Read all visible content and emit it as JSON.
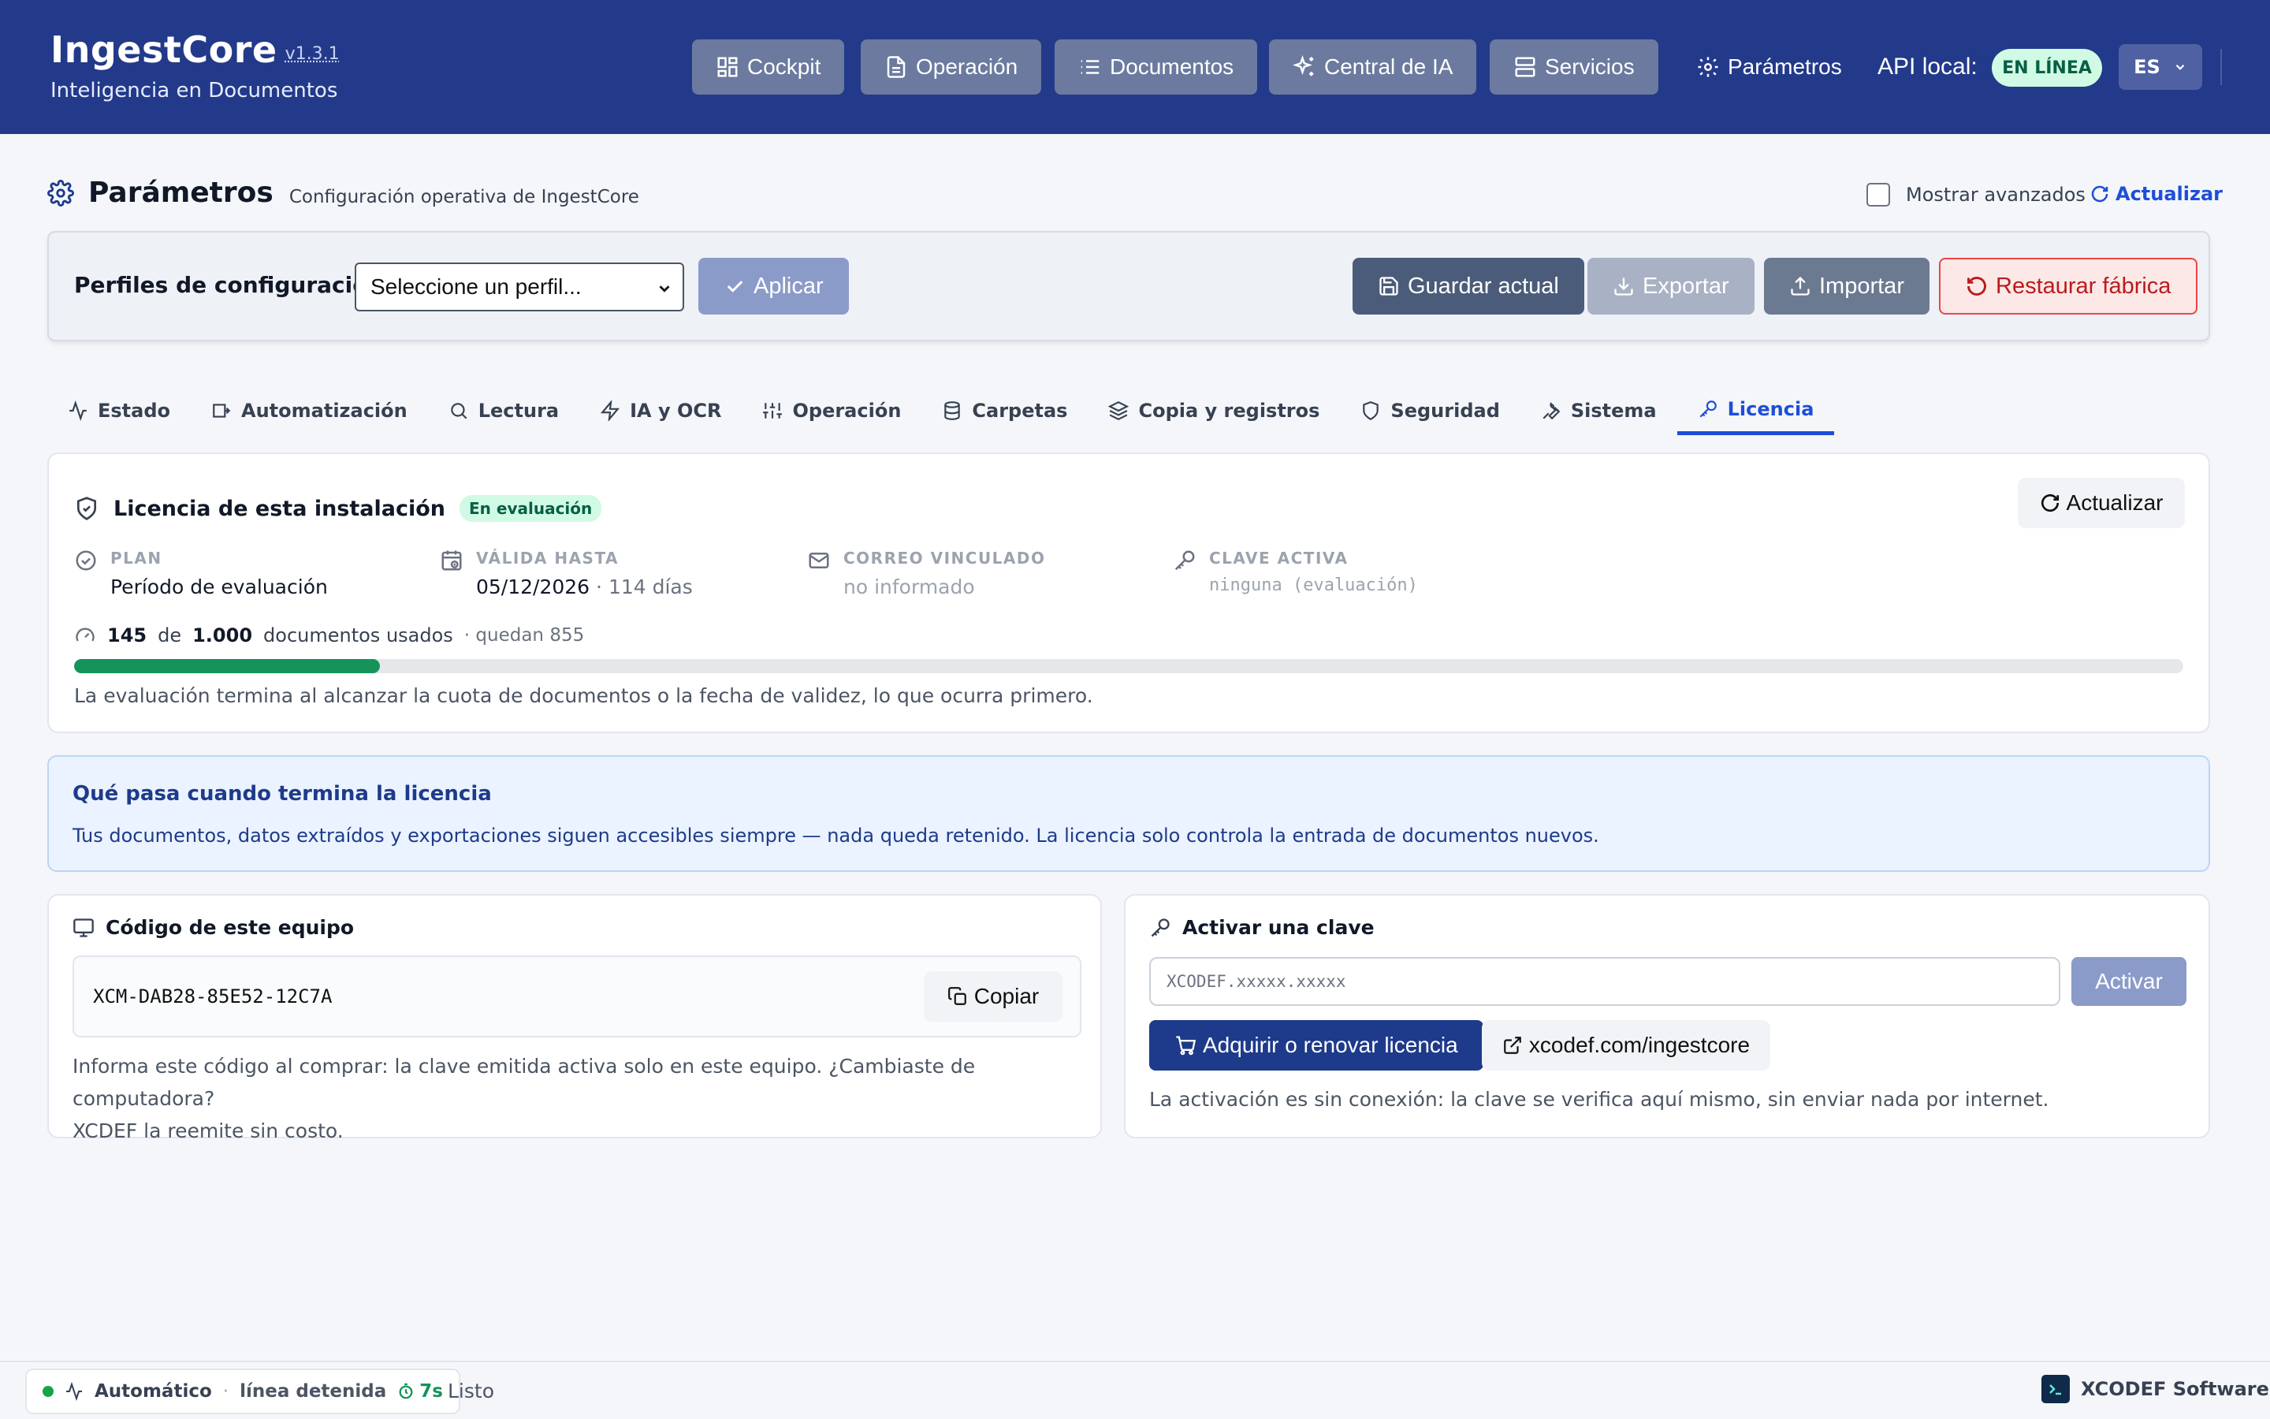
{
  "app": {
    "name": "IngestCore",
    "version": "v1.3.1",
    "subtitle": "Inteligencia en Documentos"
  },
  "nav": {
    "items": [
      {
        "label": "Cockpit",
        "icon": "dashboard-icon"
      },
      {
        "label": "Operación",
        "icon": "document-icon"
      },
      {
        "label": "Documentos",
        "icon": "list-icon"
      },
      {
        "label": "Central de IA",
        "icon": "sparkles-icon"
      },
      {
        "label": "Servicios",
        "icon": "server-icon"
      }
    ],
    "params_label": "Parámetros",
    "api_label": "API local:",
    "api_status": "EN LÍNEA",
    "language": "ES"
  },
  "page": {
    "title": "Parámetros",
    "subtitle": "Configuración operativa de IngestCore",
    "show_advanced": "Mostrar avanzados",
    "refresh": "Actualizar"
  },
  "profiles": {
    "label": "Perfiles de configuración:",
    "select_placeholder": "Seleccione un perfil...",
    "apply": "Aplicar",
    "save_current": "Guardar actual",
    "export": "Exportar",
    "import": "Importar",
    "factory_reset": "Restaurar fábrica"
  },
  "tabs": [
    {
      "label": "Estado",
      "icon": "activity-icon"
    },
    {
      "label": "Automatización",
      "icon": "inbox-icon"
    },
    {
      "label": "Lectura",
      "icon": "search-icon"
    },
    {
      "label": "IA y OCR",
      "icon": "bolt-icon"
    },
    {
      "label": "Operación",
      "icon": "sliders-icon"
    },
    {
      "label": "Carpetas",
      "icon": "database-icon"
    },
    {
      "label": "Copia y registros",
      "icon": "layers-icon"
    },
    {
      "label": "Seguridad",
      "icon": "shield-icon"
    },
    {
      "label": "Sistema",
      "icon": "wrench-icon"
    },
    {
      "label": "Licencia",
      "icon": "key-icon",
      "active": true
    }
  ],
  "license": {
    "title": "Licencia de esta instalación",
    "badge": "En evaluación",
    "refresh": "Actualizar",
    "plan_label": "PLAN",
    "plan_value": "Período de evaluación",
    "valid_label": "VÁLIDA HASTA",
    "valid_date": "05/12/2026",
    "valid_days": "· 114 días",
    "email_label": "CORREO VINCULADO",
    "email_value": "no informado",
    "key_label": "CLAVE ACTIVA",
    "key_value": "ninguna (evaluación)",
    "used": "145",
    "of": "de",
    "total": "1.000",
    "used_suffix": "documentos usados",
    "remaining": "· quedan 855",
    "usage_fraction": 0.145,
    "note": "La evaluación termina al alcanzar la cuota de documentos o la fecha de validez, lo que ocurra primero."
  },
  "end_info": {
    "title": "Qué pasa cuando termina la licencia",
    "text": "Tus documentos, datos extraídos y exportaciones siguen accesibles siempre — nada queda retenido. La licencia solo controla la entrada de documentos nuevos."
  },
  "machine": {
    "title": "Código de este equipo",
    "code": "XCM-DAB28-85E52-12C7A",
    "copy": "Copiar",
    "note_line1": "Informa este código al comprar: la clave emitida activa solo en este equipo. ¿Cambiaste de computadora?",
    "note_line2": "XCDEF la reemite sin costo."
  },
  "activate": {
    "title": "Activar una clave",
    "placeholder": "XCODEF.xxxxx.xxxxx",
    "activate": "Activar",
    "buy": "Adquirir o renovar licencia",
    "site": "xcodef.com/ingestcore",
    "note": "La activación es sin conexión: la clave se verifica aquí mismo, sin enviar nada por internet."
  },
  "footer": {
    "mode": "Automático",
    "line": "línea detenida",
    "timer": "7s",
    "status": "Listo",
    "company": "XCODEF Software"
  },
  "colors": {
    "header": "#233a8a",
    "accent": "#1d4ed8",
    "success": "#15935a",
    "danger": "#b91c1c"
  }
}
